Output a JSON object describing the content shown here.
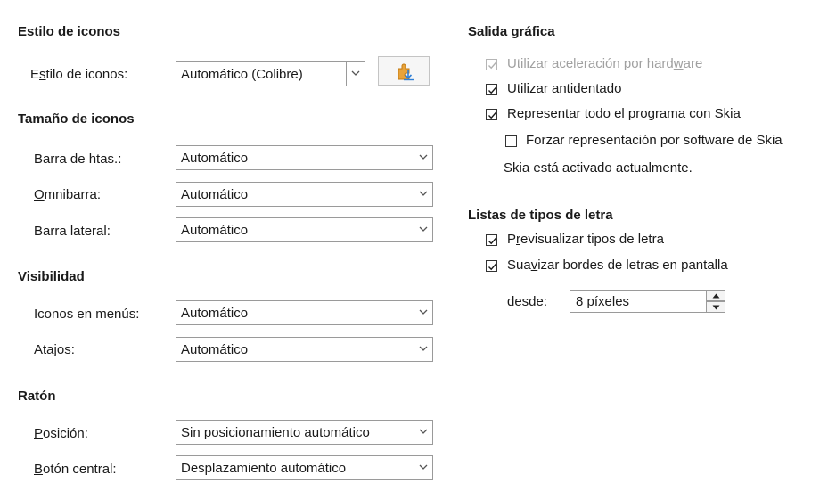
{
  "icon_style": {
    "section_title": "Estilo de iconos",
    "label_pre": "E",
    "label_ul": "s",
    "label_post": "tilo de iconos:",
    "value": "Automático (Colibre)",
    "extension_icon": "add-extension-icon"
  },
  "icon_size": {
    "section_title": "Tamaño de iconos",
    "toolbar_label": "Barra de htas.:",
    "toolbar_value": "Automático",
    "notebookbar_label_ul": "O",
    "notebookbar_label_post": "mnibarra:",
    "notebookbar_value": "Automático",
    "sidebar_label": "Barra lateral:",
    "sidebar_value": "Automático"
  },
  "visibility": {
    "section_title": "Visibilidad",
    "menu_icons_label": "Iconos en menús:",
    "menu_icons_value": "Automático",
    "shortcuts_label": "Atajos:",
    "shortcuts_value": "Automático"
  },
  "mouse": {
    "section_title": "Ratón",
    "position_label_ul": "P",
    "position_label_post": "osición:",
    "position_value": "Sin posicionamiento automático",
    "middle_label_ul": "B",
    "middle_label_post": "otón central:",
    "middle_value": "Desplazamiento automático"
  },
  "graphics_output": {
    "section_title": "Salida gráfica",
    "hw_accel_pre": "Utilizar aceleración por hard",
    "hw_accel_ul": "w",
    "hw_accel_post": "are",
    "hw_accel_checked": true,
    "hw_accel_disabled": true,
    "antialias_pre": "Utilizar anti",
    "antialias_ul": "d",
    "antialias_post": "entado",
    "antialias_checked": true,
    "skia_label": "Representar todo el programa con Skia",
    "skia_checked": true,
    "skia_sw_label": "Forzar representación por software de Skia",
    "skia_sw_checked": false,
    "skia_status": "Skia está activado actualmente."
  },
  "font_lists": {
    "section_title": "Listas de tipos de letra",
    "preview_pre": "P",
    "preview_ul": "r",
    "preview_post": "evisualizar tipos de letra",
    "preview_checked": true,
    "smooth_pre": "Sua",
    "smooth_ul": "v",
    "smooth_post": "izar bordes de letras en pantalla",
    "smooth_checked": true,
    "from_label_ul": "d",
    "from_label_post": "esde:",
    "from_value": "8 píxeles"
  },
  "colors": {
    "check": "#1a1a1a",
    "disabled": "#a0a0a0",
    "icon_orange": "#e8a33a",
    "icon_blue": "#2f7fd6"
  }
}
